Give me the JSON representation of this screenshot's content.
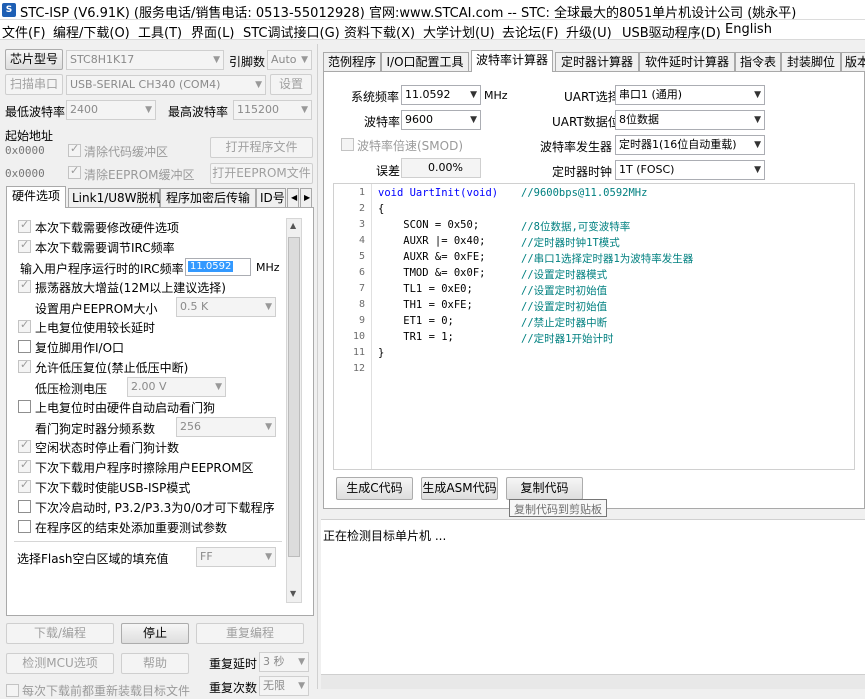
{
  "window": {
    "title": "STC-ISP (V6.91K) (服务电话/销售电话: 0513-55012928) 官网:www.STCAI.com  -- STC: 全球最大的8051单片机设计公司 (姚永平)"
  },
  "menu": [
    "文件(F)",
    "编程/下载(O)",
    "工具(T)",
    "界面(L)",
    "STC调试接口(G)",
    "资料下载(X)",
    "大学计划(U)",
    "去论坛(F)",
    "升级(U)",
    "USB驱动程序(D)",
    "English"
  ],
  "left": {
    "chip_button": "芯片型号",
    "chip_value": "STC8H1K17",
    "pins_label": "引脚数",
    "pins_value": "Auto",
    "scan_button": "扫描串口",
    "port_value": "USB-SERIAL CH340  (COM4)",
    "settings_button": "设置",
    "min_baud_label": "最低波特率",
    "min_baud_value": "2400",
    "max_baud_label": "最高波特率",
    "max_baud_value": "115200",
    "start_addr_label": "起始地址",
    "code_addr": "0x0000",
    "clear_code_label": "清除代码缓冲区",
    "open_prog_button": "打开程序文件",
    "eeprom_addr": "0x0000",
    "clear_eeprom_label": "清除EEPROM缓冲区",
    "open_eeprom_button": "打开EEPROM文件"
  },
  "hw_tabs": [
    "硬件选项",
    "Link1/U8W脱机",
    "程序加密后传输",
    "ID号"
  ],
  "hw_options": {
    "items": [
      {
        "label": "本次下载需要修改硬件选项",
        "checked": true
      },
      {
        "label": "本次下载需要调节IRC频率",
        "checked": true
      },
      {
        "label": "输入用户程序运行时的IRC频率",
        "value": "11.0592",
        "unit": "MHz"
      },
      {
        "label": "振荡器放大增益(12M以上建议选择)",
        "checked": true
      },
      {
        "label": "设置用户EEPROM大小",
        "value": "0.5 K"
      },
      {
        "label": "上电复位使用较长延时",
        "checked": true
      },
      {
        "label": "复位脚用作I/O口",
        "checked": false
      },
      {
        "label": "允许低压复位(禁止低压中断)",
        "checked": true
      },
      {
        "label": "低压检测电压",
        "value": "2.00 V"
      },
      {
        "label": "上电复位时由硬件自动启动看门狗",
        "checked": false
      },
      {
        "label": "看门狗定时器分频系数",
        "value": "256"
      },
      {
        "label": "空闲状态时停止看门狗计数",
        "checked": true
      },
      {
        "label": "下次下载用户程序时擦除用户EEPROM区",
        "checked": true
      },
      {
        "label": "下次下载时使能USB-ISP模式",
        "checked": true
      },
      {
        "label": "下次冷启动时, P3.2/P3.3为0/0才可下载程序",
        "checked": false
      },
      {
        "label": "在程序区的结束处添加重要测试参数",
        "checked": false
      },
      {
        "label": "选择Flash空白区域的填充值",
        "value": "FF"
      }
    ]
  },
  "bottom_left": {
    "download_button": "下载/编程",
    "stop_button": "停止",
    "reprogram_button": "重复编程",
    "detect_button": "检测MCU选项",
    "help_button": "帮助",
    "repeat_delay_label": "重复延时",
    "repeat_delay_value": "3 秒",
    "repeat_count_label": "重复次数",
    "repeat_count_value": "无限",
    "reload_label": "每次下载前都重新装载目标文件"
  },
  "right_tabs": [
    "范例程序",
    "I/O口配置工具",
    "波特率计算器",
    "定时器计算器",
    "软件延时计算器",
    "指令表",
    "封装脚位",
    "版本"
  ],
  "baud_calc": {
    "sysfreq_label": "系统频率",
    "sysfreq_value": "11.0592",
    "sysfreq_unit": "MHz",
    "baud_label": "波特率",
    "baud_value": "9600",
    "double_label": "波特率倍速(SMOD)",
    "error_label": "误差",
    "error_value": "0.00%",
    "uart_label": "UART选择",
    "uart_value": "串口1 (通用)",
    "databits_label": "UART数据位",
    "databits_value": "8位数据",
    "generator_label": "波特率发生器",
    "generator_value": "定时器1(16位自动重载)",
    "clock_label": "定时器时钟",
    "clock_value": "1T  (FOSC)",
    "gen_c_button": "生成C代码",
    "gen_asm_button": "生成ASM代码",
    "copy_button": "复制代码",
    "tooltip": "复制代码到剪贴板"
  },
  "code_lines": [
    {
      "n": "1",
      "text": "void UartInit(void)",
      "comment": "//9600bps@11.0592MHz"
    },
    {
      "n": "2",
      "text": "{",
      "comment": ""
    },
    {
      "n": "3",
      "text": "    SCON = 0x50;",
      "comment": "//8位数据,可变波特率"
    },
    {
      "n": "4",
      "text": "    AUXR |= 0x40;",
      "comment": "//定时器时钟1T模式"
    },
    {
      "n": "5",
      "text": "    AUXR &= 0xFE;",
      "comment": "//串口1选择定时器1为波特率发生器"
    },
    {
      "n": "6",
      "text": "    TMOD &= 0x0F;",
      "comment": "//设置定时器模式"
    },
    {
      "n": "7",
      "text": "    TL1 = 0xE0;",
      "comment": "//设置定时初始值"
    },
    {
      "n": "8",
      "text": "    TH1 = 0xFE;",
      "comment": "//设置定时初始值"
    },
    {
      "n": "9",
      "text": "    ET1 = 0;",
      "comment": "//禁止定时器中断"
    },
    {
      "n": "10",
      "text": "    TR1 = 1;",
      "comment": "//定时器1开始计时"
    },
    {
      "n": "11",
      "text": "}",
      "comment": ""
    },
    {
      "n": "12",
      "text": "",
      "comment": ""
    }
  ],
  "status": {
    "message": "正在检测目标单片机 ..."
  }
}
